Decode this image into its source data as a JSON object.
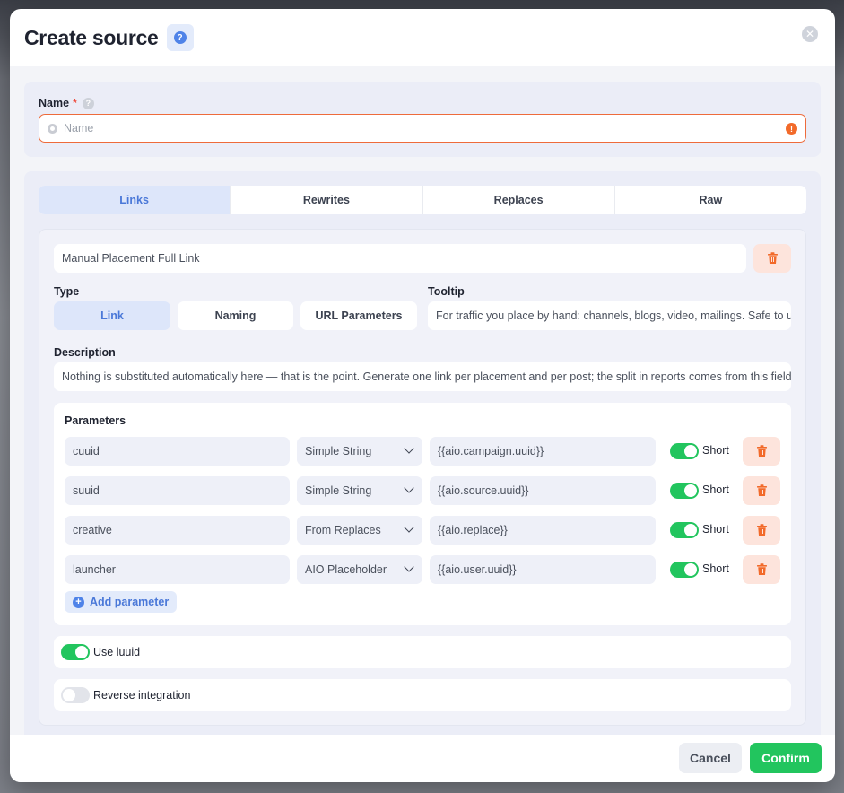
{
  "modal": {
    "title": "Create source",
    "help_icon": "question-icon",
    "close_icon": "close-icon"
  },
  "name_field": {
    "label": "Name",
    "required_mark": "*",
    "placeholder": "Name",
    "value": "",
    "warning_icon": "exclamation-icon"
  },
  "tabs": [
    {
      "label": "Links",
      "active": true
    },
    {
      "label": "Rewrites",
      "active": false
    },
    {
      "label": "Replaces",
      "active": false
    },
    {
      "label": "Raw",
      "active": false
    }
  ],
  "link": {
    "name_value": "Manual Placement Full Link",
    "type_label": "Type",
    "type_options": [
      {
        "label": "Link",
        "active": true
      },
      {
        "label": "Naming",
        "active": false
      },
      {
        "label": "URL Parameters",
        "active": false
      }
    ],
    "tooltip_label": "Tooltip",
    "tooltip_value": "For traffic you place by hand: channels, blogs, video, mailings. Safe to u",
    "description_label": "Description",
    "description_value": "Nothing is substituted automatically here — that is the point. Generate one link per placement and per post; the split in reports comes from this field p"
  },
  "parameters": {
    "title": "Parameters",
    "rows": [
      {
        "key": "cuuid",
        "type": "Simple String",
        "value": "{{aio.campaign.uuid}}",
        "short_label": "Short",
        "short_on": true
      },
      {
        "key": "suuid",
        "type": "Simple String",
        "value": "{{aio.source.uuid}}",
        "short_label": "Short",
        "short_on": true
      },
      {
        "key": "creative",
        "type": "From Replaces",
        "value": "{{aio.replace}}",
        "short_label": "Short",
        "short_on": true
      },
      {
        "key": "launcher",
        "type": "AIO Placeholder",
        "value": "{{aio.user.uuid}}",
        "short_label": "Short",
        "short_on": true
      }
    ],
    "add_label": "Add parameter"
  },
  "switches": {
    "use_luuid": {
      "label": "Use luuid",
      "on": true
    },
    "reverse_integration": {
      "label": "Reverse integration",
      "on": false
    }
  },
  "footer": {
    "cancel_label": "Cancel",
    "confirm_label": "Confirm"
  },
  "colors": {
    "accent": "#4a78d8",
    "success": "#22c55e",
    "danger": "#f26a2a",
    "danger_bg": "#fde4dc"
  }
}
